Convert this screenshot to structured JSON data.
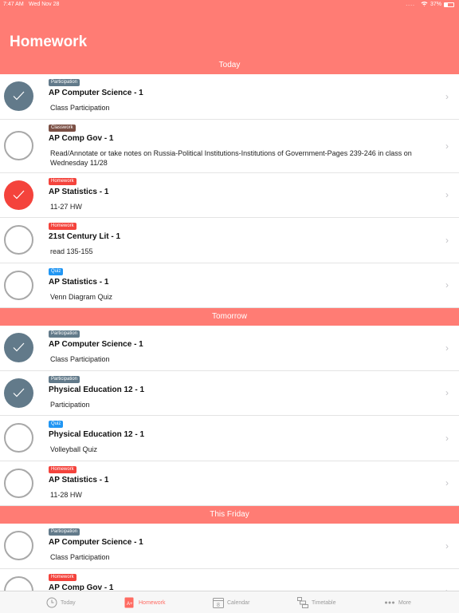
{
  "status": {
    "time": "7:47 AM",
    "date": "Wed Nov 28",
    "signal_dots": "....",
    "battery": "37%"
  },
  "header": {
    "title": "Homework"
  },
  "sections": [
    {
      "label": "Today",
      "items": [
        {
          "badge": "Participation",
          "title": "AP Computer Science - 1",
          "desc": "Class Participation"
        },
        {
          "badge": "Classwork",
          "title": "AP Comp Gov - 1",
          "desc": "Read/Annotate or take notes on Russia-Political Institutions-Institutions of Government-Pages 239-246 in class on Wednesday 11/28"
        },
        {
          "badge": "Homework",
          "title": "AP Statistics - 1",
          "desc": "11-27 HW"
        },
        {
          "badge": "Homework",
          "title": "21st Century Lit - 1",
          "desc": "read 135-155"
        },
        {
          "badge": "Quiz",
          "title": "AP Statistics - 1",
          "desc": "Venn Diagram Quiz"
        }
      ]
    },
    {
      "label": "Tomorrow",
      "items": [
        {
          "badge": "Participation",
          "title": "AP Computer Science - 1",
          "desc": "Class Participation"
        },
        {
          "badge": "Participation",
          "title": "Physical Education 12 - 1",
          "desc": "Participation"
        },
        {
          "badge": "Quiz",
          "title": "Physical Education 12 - 1",
          "desc": "Volleyball Quiz"
        },
        {
          "badge": "Homework",
          "title": "AP Statistics - 1",
          "desc": "11-28 HW"
        }
      ]
    },
    {
      "label": "This Friday",
      "items": [
        {
          "badge": "Participation",
          "title": "AP Computer Science - 1",
          "desc": "Class Participation"
        },
        {
          "badge": "Homework",
          "title": "AP Comp Gov - 1",
          "desc": ""
        }
      ]
    }
  ],
  "tabs": [
    {
      "label": "Today",
      "icon": "clock-icon"
    },
    {
      "label": "Homework",
      "icon": "homework-icon"
    },
    {
      "label": "Calendar",
      "icon": "calendar-icon"
    },
    {
      "label": "Timetable",
      "icon": "timetable-icon"
    },
    {
      "label": "More",
      "icon": "more-icon"
    }
  ],
  "calendar_day": "8",
  "colors": {
    "accent": "#ff7c74",
    "participation": "#627a8a",
    "classwork": "#7b4f44",
    "homework": "#f4433c",
    "quiz": "#2196f3",
    "active_tab": "#ff6b62"
  }
}
